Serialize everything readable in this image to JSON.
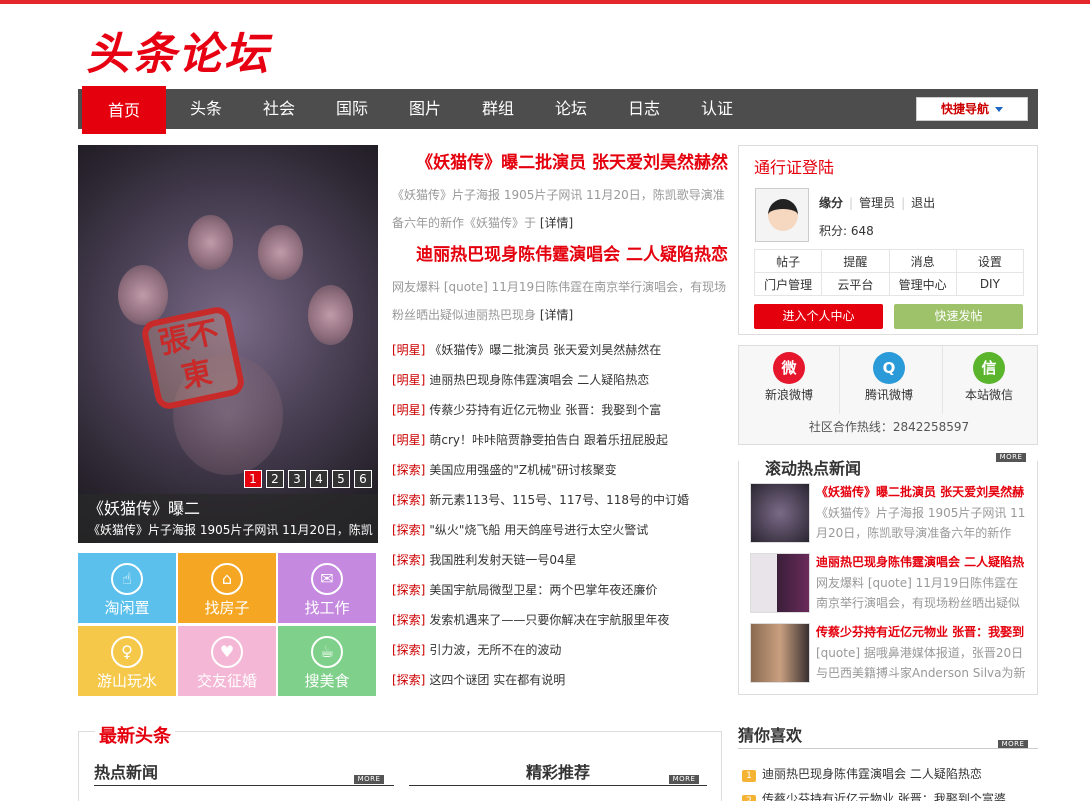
{
  "logo": "头条论坛",
  "nav": {
    "items": [
      "首页",
      "头条",
      "社会",
      "国际",
      "图片",
      "群组",
      "论坛",
      "日志",
      "认证"
    ],
    "quick_nav": "快捷导航"
  },
  "slide": {
    "seal_text": "張不東",
    "numbers": [
      "1",
      "2",
      "3",
      "4",
      "5",
      "6"
    ],
    "caption_title": "《妖猫传》曝二",
    "caption_desc": "《妖猫传》片子海报 1905片子网讯 11月20日，陈凯"
  },
  "tiles": [
    {
      "label": "淘闲置",
      "icon": "☝",
      "color": "#5bc0eb"
    },
    {
      "label": "找房子",
      "icon": "⌂",
      "color": "#f5a623"
    },
    {
      "label": "找工作",
      "icon": "✉",
      "color": "#c58ae0"
    },
    {
      "label": "游山玩水",
      "icon": "♀",
      "color": "#f5c84a"
    },
    {
      "label": "交友征婚",
      "icon": "♥",
      "color": "#f4b8d6"
    },
    {
      "label": "搜美食",
      "icon": "☕",
      "color": "#7fd08a"
    }
  ],
  "headlines": [
    {
      "title": "《妖猫传》曝二批演员 张天爱刘昊然赫然",
      "desc": "《妖猫传》片子海报 1905片子网讯 11月20日，陈凯歌导演准备六年的新作《妖猫传》于",
      "more": "[详情]"
    },
    {
      "title": "迪丽热巴现身陈伟霆演唱会 二人疑陷热恋",
      "desc": "网友爆料 [quote] 11月19日陈伟霆在南京举行演唱会，有现场粉丝晒出疑似迪丽热巴现身",
      "more": "[详情]"
    }
  ],
  "news": [
    {
      "cat": "[明星]",
      "title": "《妖猫传》曝二批演员 张天爱刘昊然赫然在"
    },
    {
      "cat": "[明星]",
      "title": "迪丽热巴现身陈伟霆演唱会 二人疑陷热恋"
    },
    {
      "cat": "[明星]",
      "title": "传蔡少芬持有近亿元物业 张晋：我娶到个富"
    },
    {
      "cat": "[明星]",
      "title": "萌cry！咔咔陪贾静雯拍告白 跟着乐扭屁股起"
    },
    {
      "cat": "[探索]",
      "title": "美国应用强盛的\"Z机械\"研讨核聚变"
    },
    {
      "cat": "[探索]",
      "title": "新元素113号、115号、117号、118号的中订婚"
    },
    {
      "cat": "[探索]",
      "title": "\"纵火\"烧飞船 用天鸽座号进行太空火警试"
    },
    {
      "cat": "[探索]",
      "title": "我国胜利发射天链一号04星"
    },
    {
      "cat": "[探索]",
      "title": "美国宇航局微型卫星：两个巴掌年夜还廉价"
    },
    {
      "cat": "[探索]",
      "title": "发索机遇来了——只要你解决在宇航服里年夜"
    },
    {
      "cat": "[探索]",
      "title": "引力波，无所不在的波动"
    },
    {
      "cat": "[探索]",
      "title": "这四个谜团 实在都有说明"
    }
  ],
  "login": {
    "title": "通行证登陆",
    "username": "缘分",
    "role": "管理员",
    "logout": "退出",
    "points": "积分: 648",
    "grid": [
      [
        "帖子",
        "提醒",
        "消息",
        "设置"
      ],
      [
        "门户管理",
        "云平台",
        "管理中心",
        "DIY"
      ]
    ],
    "btn_center": "进入个人中心",
    "btn_post": "快速发帖"
  },
  "social": {
    "items": [
      {
        "label": "新浪微博",
        "icon": "微",
        "color": "#e6162d"
      },
      {
        "label": "腾讯微博",
        "icon": "Q",
        "color": "#2b9ad8"
      },
      {
        "label": "本站微信",
        "icon": "信",
        "color": "#5ab42c"
      }
    ],
    "hotline": "社区合作热线：2842258597"
  },
  "scroll": {
    "title": "滚动热点新闻",
    "more": "MORE",
    "items": [
      {
        "title": "《妖猫传》曝二批演员 张天爱刘昊然赫",
        "desc": "《妖猫传》片子海报 1905片子网讯 11月20日，陈凯歌导演准备六年的新作"
      },
      {
        "title": "迪丽热巴现身陈伟霆演唱会 二人疑陷热",
        "desc": "网友爆料 [quote] 11月19日陈伟霆在南京举行演唱会，有现场粉丝晒出疑似"
      },
      {
        "title": "传蔡少芬持有近亿元物业 张晋：我娶到",
        "desc": "[quote] 据哦鼻港媒体报道，张晋20日与巴西美籍搏斗家Anderson Silva为新"
      }
    ]
  },
  "latest": {
    "title": "最新头条",
    "col1": "热点新闻",
    "col2": "精彩推荐",
    "more": "MORE"
  },
  "guess": {
    "title": "猜你喜欢",
    "more": "MORE",
    "items": [
      {
        "num": "1",
        "title": "迪丽热巴现身陈伟霆演唱会 二人疑陷热恋"
      },
      {
        "num": "2",
        "title": "传蔡少芬持有近亿元物业 张晋：我娶到个富婆"
      }
    ]
  }
}
